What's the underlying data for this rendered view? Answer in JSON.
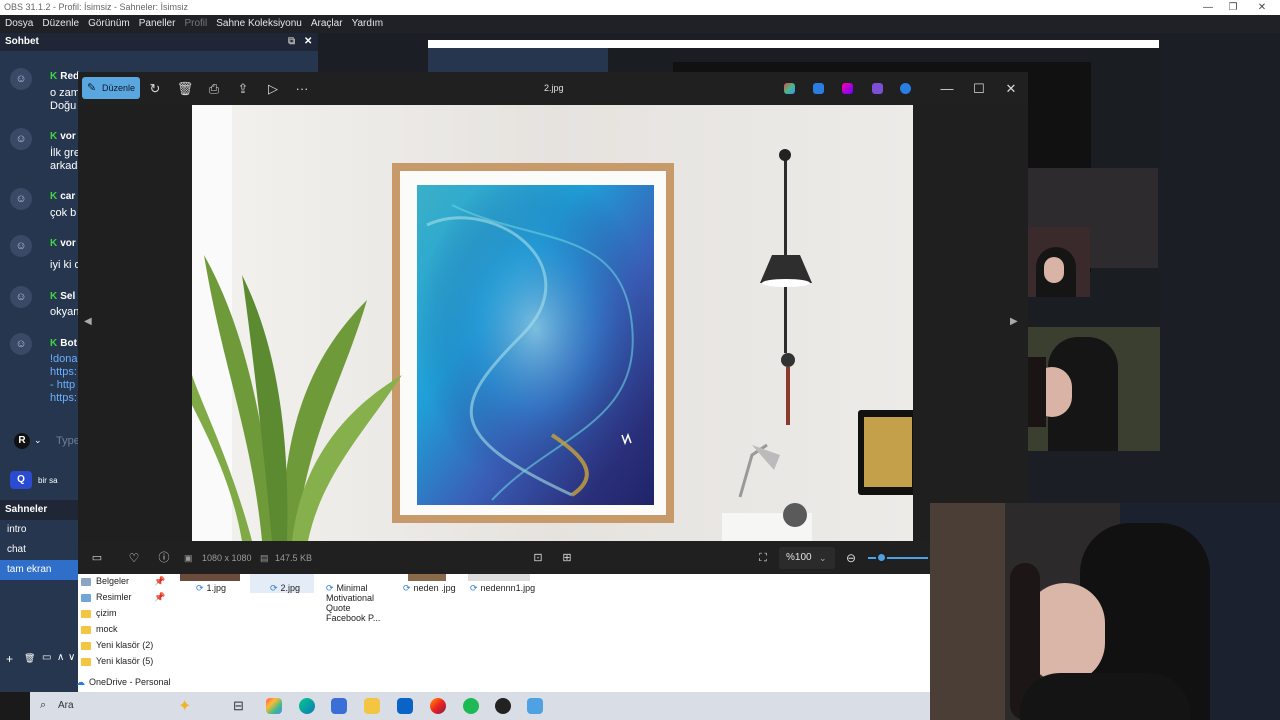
{
  "obs": {
    "title": "OBS 31.1.2 - Profil: İsimsiz - Sahneler: İsimsiz",
    "menu": [
      "Dosya",
      "Düzenle",
      "Görünüm",
      "Paneller",
      "Profil",
      "Sahne Koleksiyonu",
      "Araçlar",
      "Yardım"
    ],
    "window_controls": [
      "—",
      "❐",
      "✕"
    ]
  },
  "chat": {
    "title": "Sohbet",
    "header_icons": [
      "⧉",
      "✕"
    ],
    "messages": [
      {
        "user": "Red",
        "text": "o zam\nDoğu"
      },
      {
        "user": "vor",
        "text": "İlk gre\narkad"
      },
      {
        "user": "car",
        "text": "çok b"
      },
      {
        "user": "vor",
        "text": "iyi ki d"
      },
      {
        "user": "Sel",
        "text": "okyan"
      },
      {
        "user": "Bot",
        "text": "!dona\nhttps:\n- http\nhttps:"
      }
    ],
    "input_avatar": "R",
    "input_placeholder": "Type",
    "bottom_text": "bir sa"
  },
  "scenes": {
    "title": "Sahneler",
    "items": [
      {
        "label": "intro",
        "active": false
      },
      {
        "label": "chat",
        "active": false
      },
      {
        "label": "tam ekran",
        "active": true
      }
    ],
    "controls": [
      "+",
      "🗑",
      "▭",
      "∧",
      "∨"
    ]
  },
  "viewer": {
    "edit_label": "Düzenle",
    "title": "2.jpg",
    "toolbar_icons": [
      "rotate-icon",
      "delete-icon",
      "print-icon",
      "share-icon",
      "slideshow-icon",
      "more-icon"
    ],
    "more": "···",
    "window_controls": [
      "—",
      "☐",
      "✕"
    ],
    "resolution": "1080 x 1080",
    "file_size": "147.5 KB",
    "zoom": "%100",
    "zoom_level": 0.1
  },
  "explorer": {
    "nav": [
      {
        "label": "Belgeler",
        "pinned": true
      },
      {
        "label": "Resimler",
        "pinned": true
      },
      {
        "label": "çizim",
        "pinned": false
      },
      {
        "label": "mock",
        "pinned": false
      },
      {
        "label": "Yeni klasör (2)",
        "pinned": false
      },
      {
        "label": "Yeni klasör (5)",
        "pinned": false
      }
    ],
    "onedrive": "OneDrive - Personal",
    "files": [
      {
        "name": "1.jpg"
      },
      {
        "name": "2.jpg"
      },
      {
        "name": "Minimal Motivational Quote Facebook P..."
      },
      {
        "name": "neden .jpg"
      },
      {
        "name": "nedennn1.jpg"
      }
    ]
  },
  "taskbar": {
    "search_placeholder": "Ara",
    "icons": [
      "copilot-icon",
      "task-view-icon",
      "chrome-icon",
      "edge-icon",
      "store-icon",
      "files-icon",
      "outlook-icon",
      "firefox-icon",
      "spotify-icon",
      "obs-icon",
      "photos-icon"
    ]
  },
  "colors": {
    "accent": "#5aa6df",
    "obs_panel": "#26364f",
    "scene_active": "#2f6fc9",
    "chat_badge": "#3fd63f"
  }
}
